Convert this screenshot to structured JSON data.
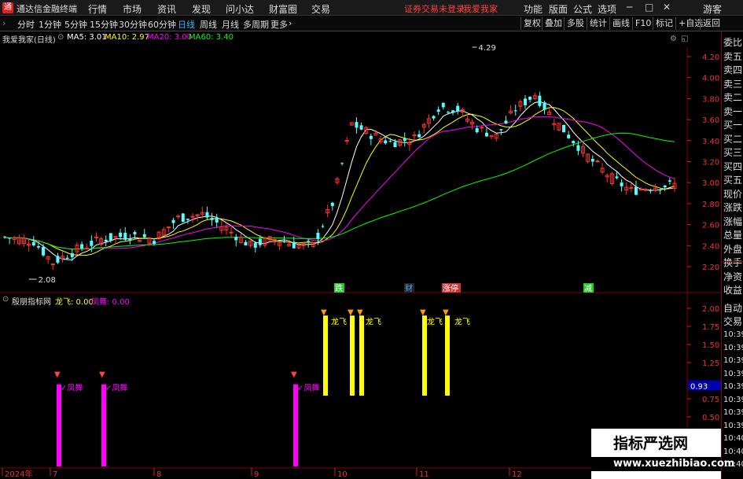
{
  "window": {
    "app_name": "通达信金融终端",
    "menus": [
      "行情",
      "市场",
      "资讯",
      "发现",
      "问小达",
      "财富圈",
      "交易"
    ],
    "center_title": "证券交易未登录",
    "stock_title": "我爱我家",
    "right_menus": [
      "功能",
      "版面",
      "公式",
      "选项"
    ],
    "user": "游客"
  },
  "toolbar": {
    "periods": [
      "分时",
      "1分钟",
      "5分钟",
      "15分钟",
      "30分钟",
      "60分钟",
      "日线",
      "周线",
      "月线",
      "多周期",
      "更多"
    ],
    "active_period": "日线",
    "buttons": [
      "复权",
      "叠加",
      "多股",
      "统计",
      "画线",
      "F10",
      "标记",
      "+自选",
      "返回"
    ]
  },
  "main_legend": {
    "title": "我爱我家(日线)",
    "ma5": "MA5: 3.01",
    "ma10": "MA10: 2.97",
    "ma20": "MA20: 3.00",
    "ma60": "MA60: 3.40",
    "colors": {
      "ma5": "#ffffff",
      "ma10": "#ffff00",
      "ma20": "#ff00ff",
      "ma60": "#00ff00"
    }
  },
  "price_axis": [
    "4.20",
    "4.00",
    "3.80",
    "3.60",
    "3.40",
    "3.20",
    "3.00",
    "2.80",
    "2.60",
    "2.40",
    "2.20"
  ],
  "price_annotations": {
    "high": "4.29",
    "low": "2.08"
  },
  "event_markers": [
    "跌",
    "财",
    "涨停",
    "减"
  ],
  "indicator_legend": {
    "name": "殷朋指标网",
    "longfei": "龙飞: 0.00",
    "fengwu": "凤舞: 0.00"
  },
  "indicator_axis": [
    "2.00",
    "1.75",
    "1.50",
    "1.25",
    "0.93",
    "0.75",
    "0.50"
  ],
  "indicator_signals": {
    "longfei_label": "龙飞",
    "fengwu_label": "✓凤舞"
  },
  "date_axis": [
    "2024年",
    "7",
    "8",
    "9",
    "10",
    "11",
    "12"
  ],
  "right_panel": {
    "top_items": [
      "委比",
      "卖五",
      "卖四",
      "卖三",
      "卖二",
      "卖一",
      "买一",
      "买二",
      "买三",
      "买四",
      "买五",
      "现价",
      "涨跌",
      "涨幅",
      "总量",
      "外盘",
      "换手",
      "净资",
      "收益"
    ],
    "bottom_items": [
      "自动",
      "交易",
      "10:39",
      "10:39",
      "10:39",
      "10:39",
      "10:39",
      "10:39",
      "10:39",
      "10:39",
      "10:40",
      "10:40",
      "10:40"
    ]
  },
  "watermark": {
    "line1": "指标严选网",
    "line2": "www.xuezhibiao.com"
  }
}
